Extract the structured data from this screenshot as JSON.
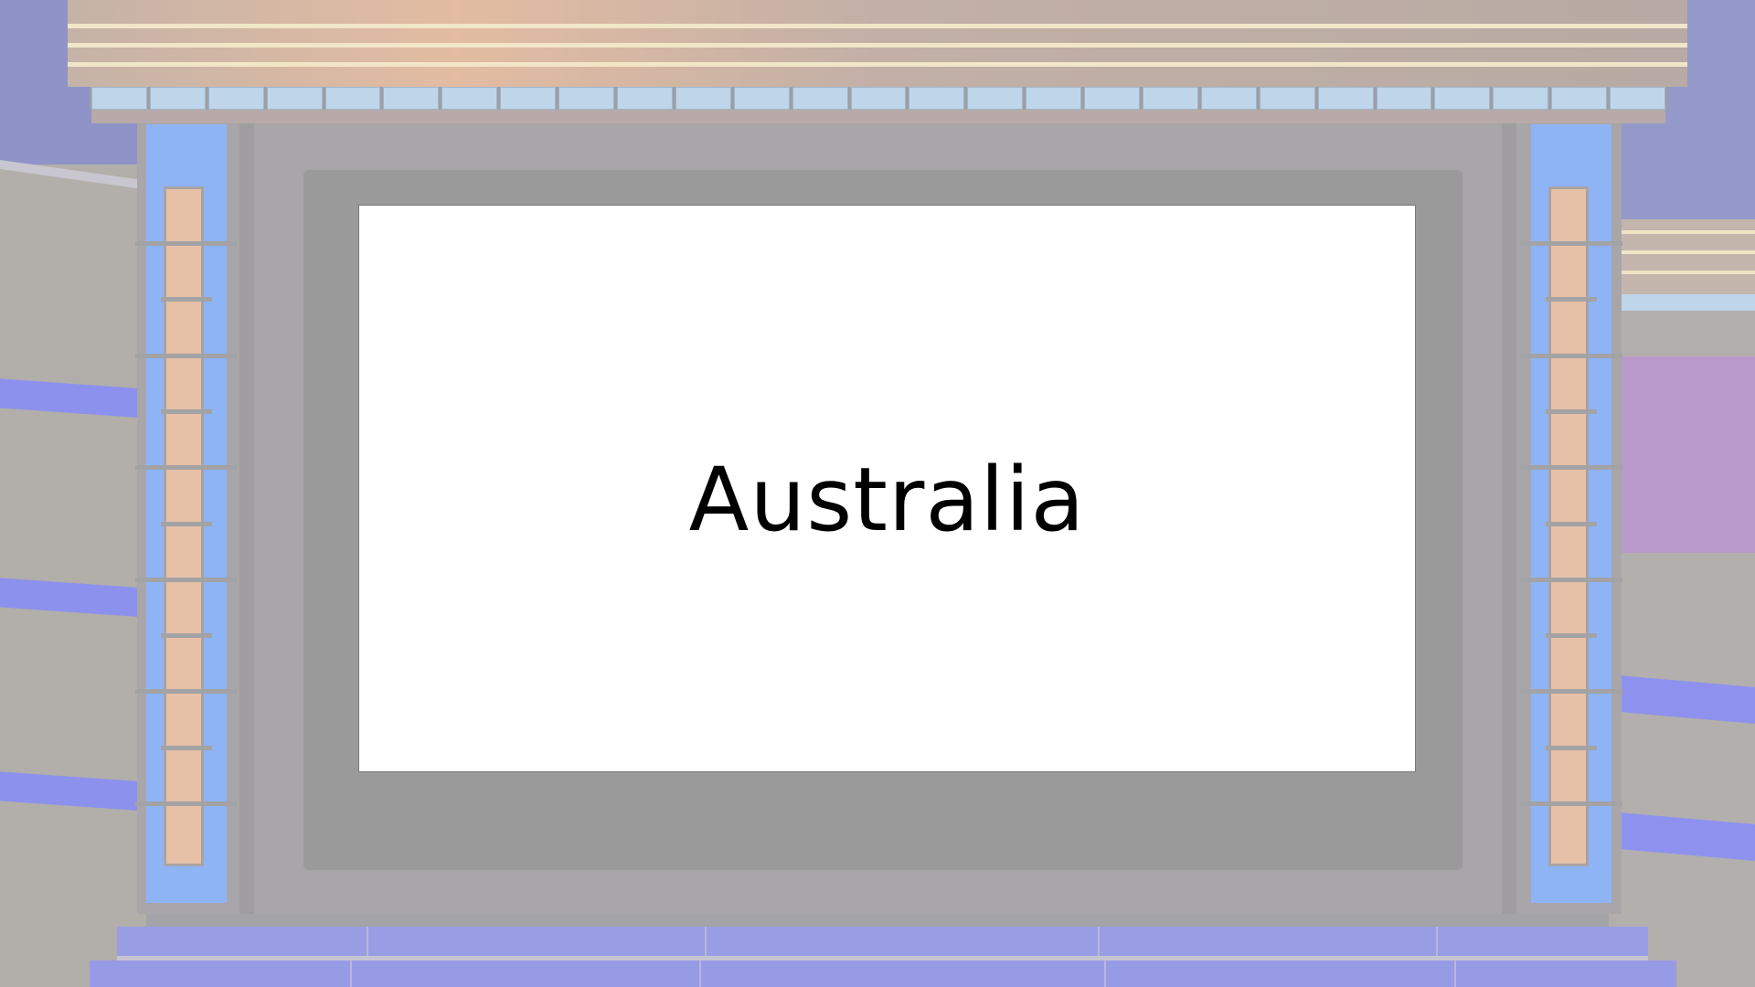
{
  "screen": {
    "text": "Australia"
  },
  "colors": {
    "background_purple": "#8f93c7",
    "header_peach": "#e3bca2",
    "tile_blue": "#bfd5ea",
    "pillar_blue": "#8eb4f6",
    "pillar_core": "#e6c0a7",
    "screen_frame": "#9a9a9a",
    "screen_white": "#ffffff",
    "floor_violet": "#999de4"
  }
}
